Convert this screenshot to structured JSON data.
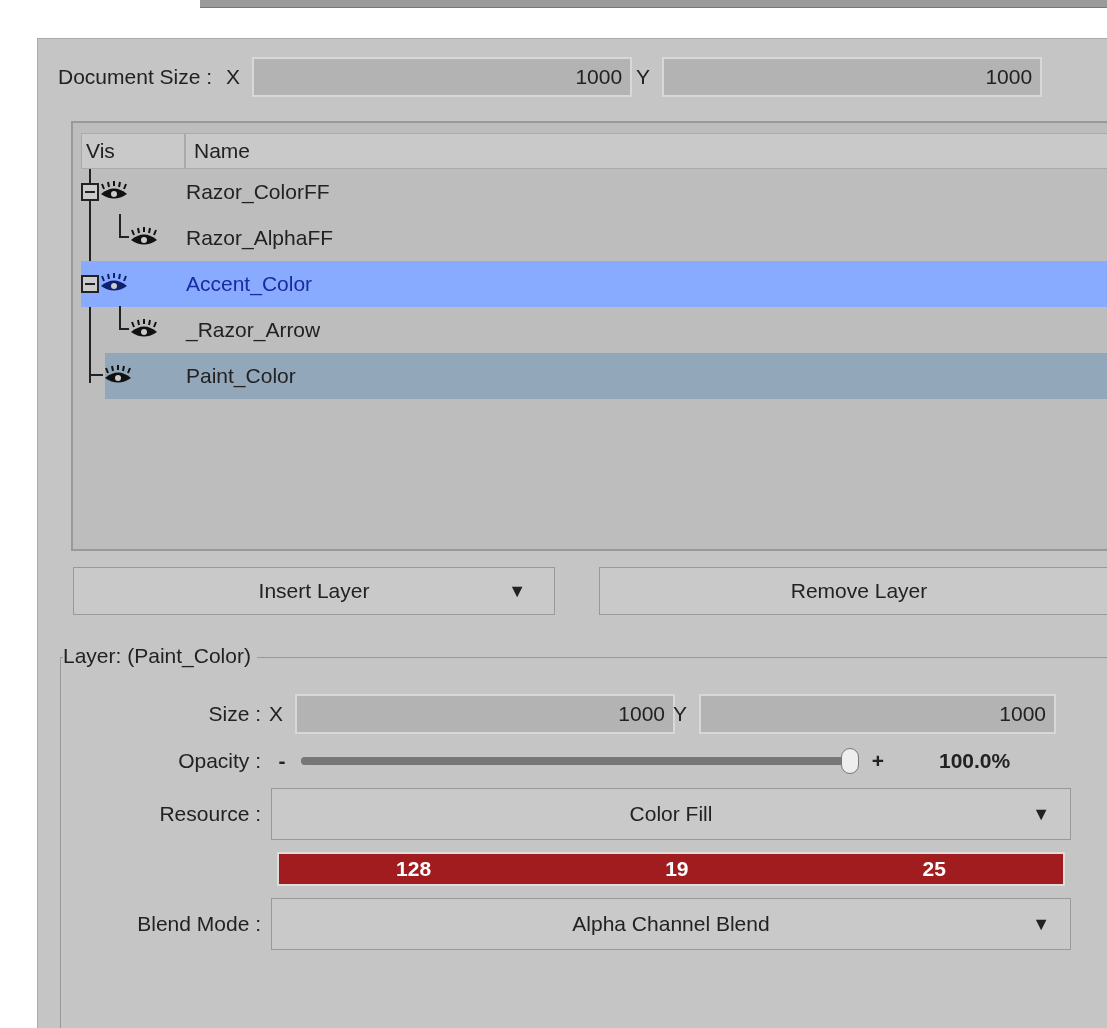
{
  "document_size": {
    "label": "Document Size :",
    "x_label": "X",
    "x_value": "1000",
    "y_label": "Y",
    "y_value": "1000"
  },
  "layers": {
    "columns": [
      "Vis",
      "Name"
    ],
    "items": [
      {
        "name": "Razor_ColorFF",
        "visible": true,
        "expanded": true,
        "selected": false,
        "active": false,
        "children": [
          {
            "name": "Razor_AlphaFF",
            "visible": true,
            "selected": false,
            "active": false
          }
        ]
      },
      {
        "name": "Accent_Color",
        "visible": true,
        "expanded": true,
        "selected": true,
        "active": false,
        "children": [
          {
            "name": "_Razor_Arrow",
            "visible": true,
            "selected": false,
            "active": false
          }
        ]
      },
      {
        "name": "Paint_Color",
        "visible": true,
        "selected": false,
        "active": true
      }
    ]
  },
  "buttons": {
    "insert": "Insert Layer",
    "insert_caret": "▼",
    "remove": "Remove Layer"
  },
  "layer": {
    "title": "Layer: (Paint_Color)",
    "size": {
      "label": "Size :",
      "x_label": "X",
      "x_value": "1000",
      "y_label": "Y",
      "y_value": "1000"
    },
    "opacity": {
      "label": "Opacity :",
      "minus": "-",
      "plus": "+",
      "level": 1,
      "reading": "100.0%"
    },
    "resource": {
      "label": "Resource :",
      "value": "Color Fill",
      "caret": "▼"
    },
    "color": {
      "color": "#a01c1e",
      "values": [
        "128",
        "19",
        "25"
      ]
    },
    "blend_mode": {
      "label": "Blend Mode :",
      "value": "Alpha Channel Blend",
      "caret": "▼"
    }
  }
}
